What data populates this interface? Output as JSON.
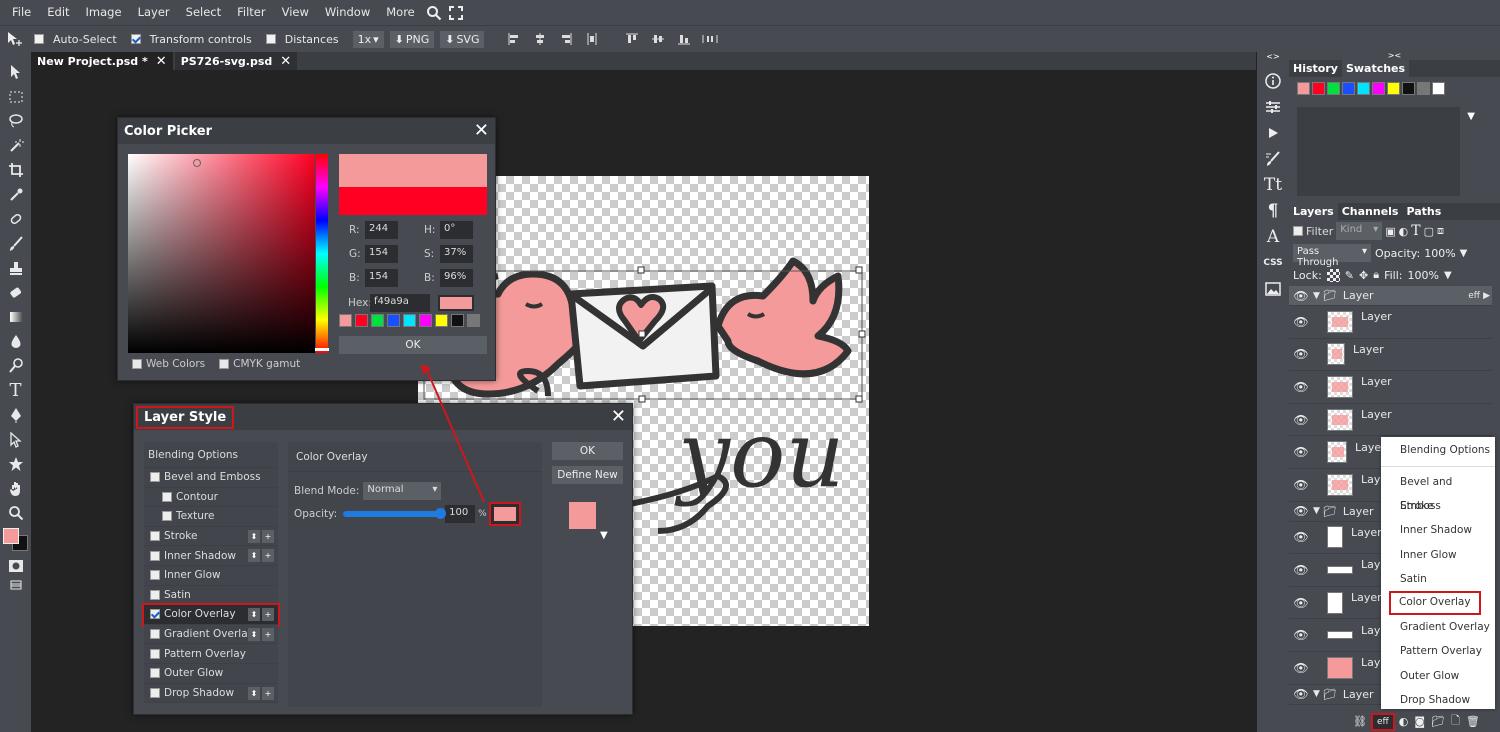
{
  "menubar": {
    "items": [
      "File",
      "Edit",
      "Image",
      "Layer",
      "Select",
      "Filter",
      "View",
      "Window",
      "More"
    ]
  },
  "options": {
    "auto_select": "Auto-Select",
    "transform_controls": "Transform controls",
    "distances": "Distances",
    "zoom": "1x",
    "png": "PNG",
    "svg": "SVG"
  },
  "tabs": [
    {
      "label": "New Project.psd *"
    },
    {
      "label": "PS726-svg.psd"
    }
  ],
  "color_picker": {
    "title": "Color Picker",
    "r_label": "R:",
    "r": "244",
    "g_label": "G:",
    "g": "154",
    "b_label": "B:",
    "b": "154",
    "h_label": "H:",
    "h": "0°",
    "s_label": "S:",
    "s": "37%",
    "v_label": "B:",
    "v": "96%",
    "hex_label": "Hex:",
    "hex": "f49a9a",
    "ok": "OK",
    "web_colors": "Web Colors",
    "cmyk": "CMYK gamut",
    "new_color": "#f49a9a",
    "old_color": "#ff0022",
    "swatches": [
      "#f49a9a",
      "#ff0022",
      "#00e040",
      "#1a4fff",
      "#00e5ff",
      "#ff00ff",
      "#ffff00",
      "#111111",
      "#777777"
    ]
  },
  "layer_style": {
    "title": "Layer Style",
    "items": [
      {
        "label": "Blending Options"
      },
      {
        "label": "Bevel and Emboss"
      },
      {
        "label": "Contour"
      },
      {
        "label": "Texture"
      },
      {
        "label": "Stroke"
      },
      {
        "label": "Inner Shadow"
      },
      {
        "label": "Inner Glow"
      },
      {
        "label": "Satin"
      },
      {
        "label": "Color Overlay"
      },
      {
        "label": "Gradient Overlay"
      },
      {
        "label": "Pattern Overlay"
      },
      {
        "label": "Outer Glow"
      },
      {
        "label": "Drop Shadow"
      }
    ],
    "section_title": "Color Overlay",
    "blend_mode_label": "Blend Mode:",
    "blend_mode": "Normal",
    "opacity_label": "Opacity:",
    "opacity": "100",
    "opacity_unit": "%",
    "opacity_value": 1.0,
    "ok": "OK",
    "define_new": "Define New",
    "overlay_color": "#f49a9a"
  },
  "panels": {
    "history_tab": "History",
    "swatches_tab": "Swatches",
    "swatches": [
      "#f49a9a",
      "#ff0022",
      "#00e040",
      "#1a4fff",
      "#00e5ff",
      "#ff00ff",
      "#ffff00",
      "#111111",
      "#777777",
      "#ffffff"
    ],
    "layers_tab": "Layers",
    "channels_tab": "Channels",
    "paths_tab": "Paths",
    "filter_label": "Filter",
    "kind": "Kind",
    "blend": "Pass Through",
    "opacity_label": "Opacity:",
    "opacity": "100%",
    "lock_label": "Lock:",
    "fill_label": "Fill:",
    "fill": "100%",
    "layers": [
      {
        "label": "Layer",
        "type": "group",
        "badge": "eff"
      },
      {
        "label": "Layer"
      },
      {
        "label": "Layer"
      },
      {
        "label": "Layer"
      },
      {
        "label": "Layer"
      },
      {
        "label": "Layer"
      },
      {
        "label": "Layer"
      },
      {
        "label": "Layer",
        "type": "group"
      },
      {
        "label": "Layer"
      },
      {
        "label": "Layer"
      },
      {
        "label": "Layer"
      },
      {
        "label": "Layer"
      },
      {
        "label": "Layer"
      },
      {
        "label": "Layer",
        "type": "group"
      }
    ],
    "eff_button": "eff"
  },
  "context_menu": {
    "items": [
      "Blending Options",
      "Bevel and Emboss",
      "Stroke",
      "Inner Shadow",
      "Inner Glow",
      "Satin",
      "Color Overlay",
      "Gradient Overlay",
      "Pattern Overlay",
      "Outer Glow",
      "Drop Shadow"
    ]
  },
  "artwork": {
    "text": "you"
  },
  "colors": {
    "fg": "#f49a9a",
    "bg": "#111111",
    "accent_red": "#d0161d"
  }
}
